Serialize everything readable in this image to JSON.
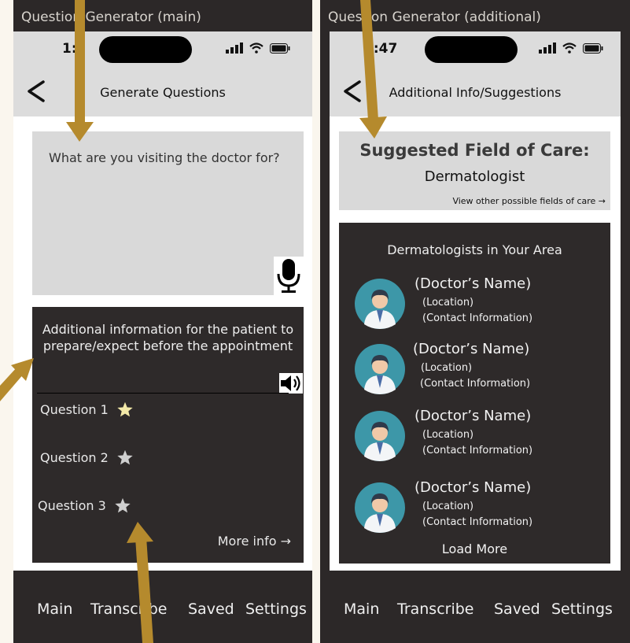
{
  "colors": {
    "arrow": "#b58a2d",
    "frame": "#2c2828",
    "panel_light": "#d9d9d9",
    "panel_dark": "#2e2a2a",
    "star_active": "#f3e9a8",
    "star_inactive": "#cfcfcf"
  },
  "left": {
    "frame_title": "Question Generator (main)",
    "status_time": "1:",
    "nav_title": "Generate Questions",
    "input_prompt": "What are you visiting the doctor for?",
    "info_line1": "Additional information for the patient to",
    "info_line2": "prepare/expect before the appointment",
    "questions": [
      {
        "label": "Question 1",
        "starred": true
      },
      {
        "label": "Question 2",
        "starred": false
      },
      {
        "label": "Question 3",
        "starred": false
      }
    ],
    "more_info": "More info →",
    "tabs": [
      "Main",
      "Transcribe",
      "Saved",
      "Settings"
    ]
  },
  "right": {
    "frame_title": "Question Generator (additional)",
    "status_time": "1:47",
    "nav_title": "Additional Info/Suggestions",
    "field_heading": "Suggested Field of Care:",
    "field_value": "Dermatologist",
    "field_link": "View other possible fields of care →",
    "area_title": "Dermatologists in Your Area",
    "doctors": [
      {
        "name": "(Doctor’s Name)",
        "location": "(Location)",
        "contact": "(Contact Information)"
      },
      {
        "name": "(Doctor’s Name)",
        "location": "(Location)",
        "contact": "(Contact Information)"
      },
      {
        "name": "(Doctor’s Name)",
        "location": "(Location)",
        "contact": "(Contact Information)"
      },
      {
        "name": "(Doctor’s Name)",
        "location": "(Location)",
        "contact": "(Contact Information)"
      }
    ],
    "load_more": "Load More",
    "tabs": [
      "Main",
      "Transcribe",
      "Saved",
      "Settings"
    ]
  },
  "icons": [
    "back-chevron-icon",
    "signal-icon",
    "wifi-icon",
    "battery-icon",
    "microphone-icon",
    "speaker-icon",
    "star-icon",
    "doctor-avatar-icon"
  ]
}
